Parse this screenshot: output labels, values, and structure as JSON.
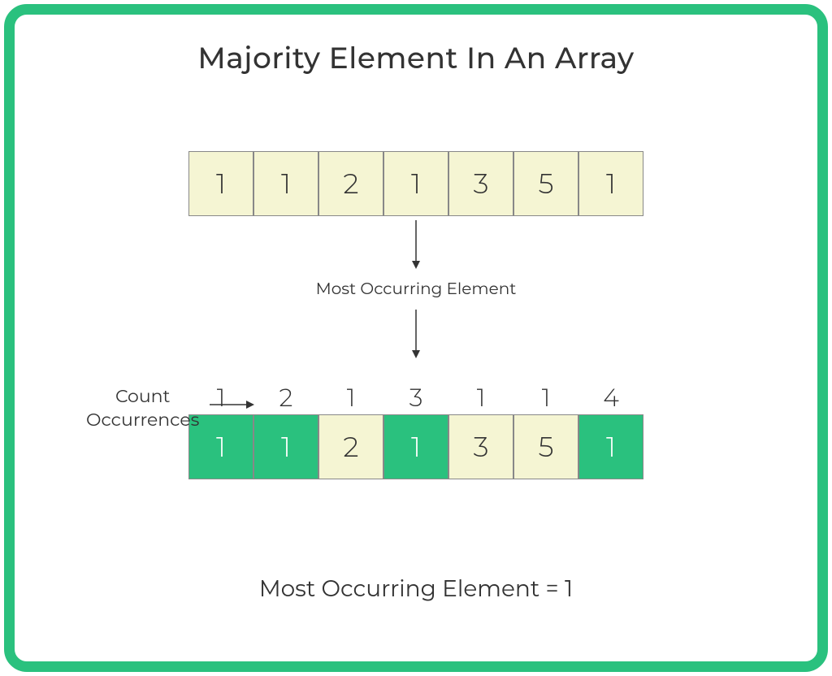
{
  "title": "Majority Element In An Array",
  "top_array": [
    "1",
    "1",
    "2",
    "1",
    "3",
    "5",
    "1"
  ],
  "arrow_label": "Most Occurring Element",
  "count_label_line1": "Count",
  "count_label_line2": "Occurrences",
  "counts": [
    "1",
    "2",
    "1",
    "3",
    "1",
    "1",
    "4"
  ],
  "bottom_array": [
    {
      "val": "1",
      "highlight": true
    },
    {
      "val": "1",
      "highlight": true
    },
    {
      "val": "2",
      "highlight": false
    },
    {
      "val": "1",
      "highlight": true
    },
    {
      "val": "3",
      "highlight": false
    },
    {
      "val": "5",
      "highlight": false
    },
    {
      "val": "1",
      "highlight": true
    }
  ],
  "result": "Most Occurring Element = 1"
}
